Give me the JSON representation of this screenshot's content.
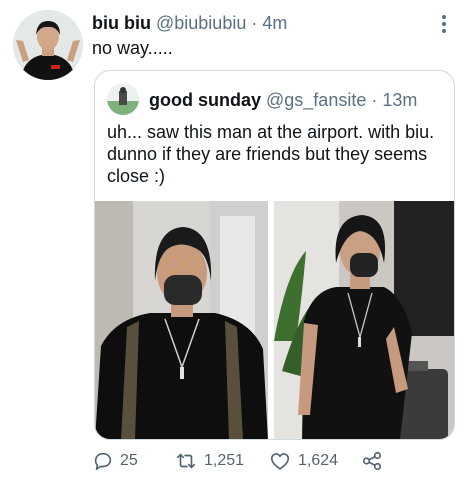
{
  "tweet": {
    "author_name": "biu biu",
    "handle": "@biubiubiu",
    "separator": "·",
    "time": "4m",
    "text": "no way....."
  },
  "quoted_tweet": {
    "author_name": "good sunday",
    "handle": "@gs_fansite",
    "separator": "·",
    "time": "13m",
    "text": "uh... saw this man at the airport. with biu. dunno if they are friends but they seems close :)"
  },
  "actions": {
    "reply_count": "25",
    "retweet_count": "1,251",
    "like_count": "1,624"
  },
  "icons": [
    "more-icon",
    "reply-icon",
    "retweet-icon",
    "like-icon",
    "share-icon"
  ]
}
